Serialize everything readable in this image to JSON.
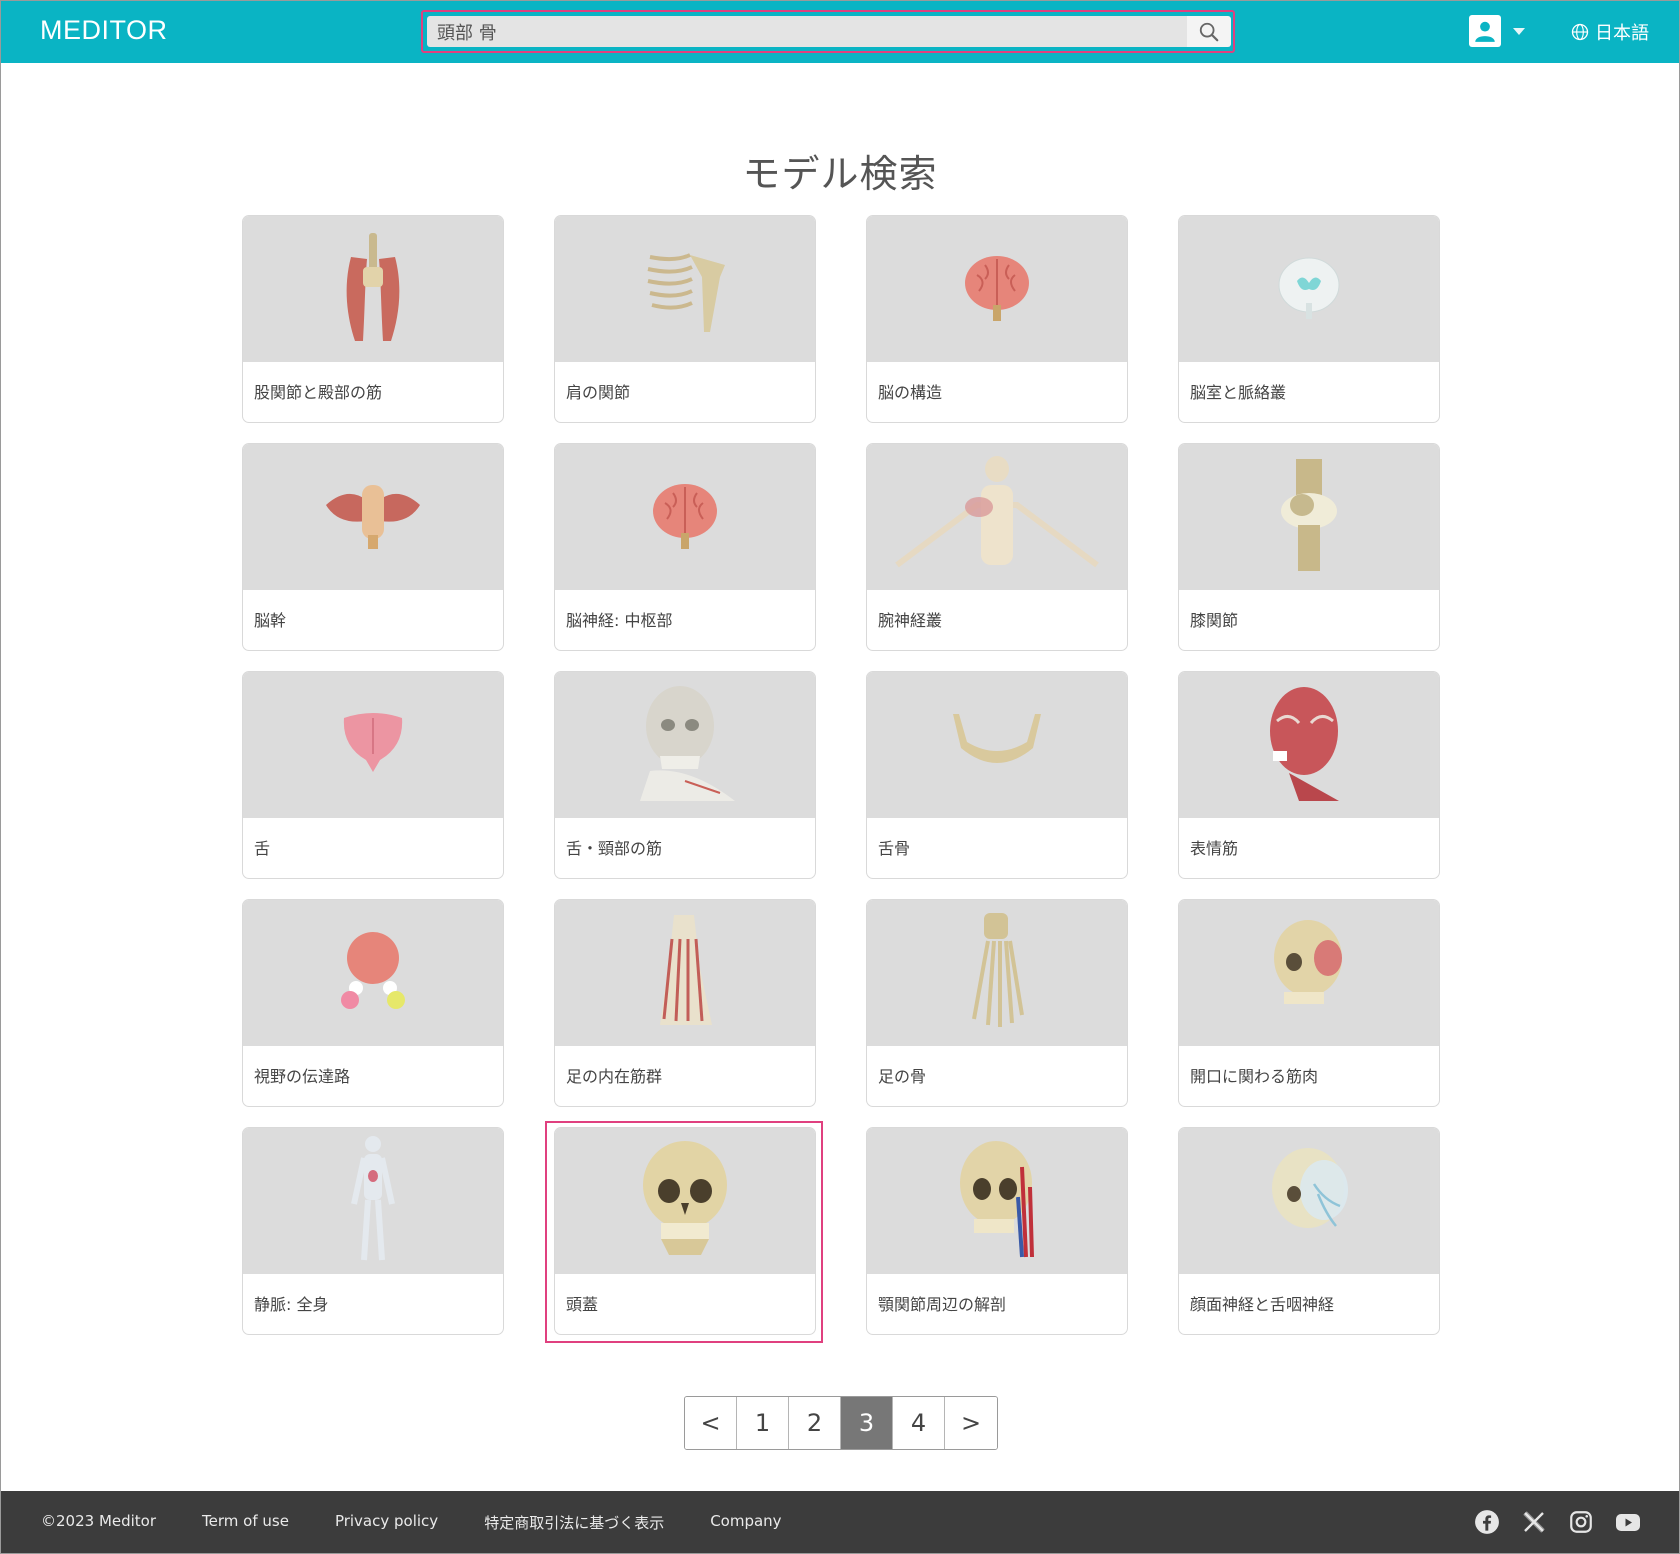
{
  "header": {
    "logo": "MEDITOR",
    "search_value": "頭部 骨",
    "language_label": "日本語"
  },
  "page": {
    "title": "モデル検索"
  },
  "models": [
    {
      "label": "股関節と殿部の筋",
      "icon": "hip-muscles-icon"
    },
    {
      "label": "肩の関節",
      "icon": "shoulder-joint-icon"
    },
    {
      "label": "脳の構造",
      "icon": "brain-icon"
    },
    {
      "label": "脳室と脈絡叢",
      "icon": "ventricles-icon"
    },
    {
      "label": "脳幹",
      "icon": "brainstem-icon"
    },
    {
      "label": "脳神経: 中枢部",
      "icon": "brain-icon"
    },
    {
      "label": "腕神経叢",
      "icon": "brachial-plexus-icon"
    },
    {
      "label": "膝関節",
      "icon": "knee-joint-icon"
    },
    {
      "label": "舌",
      "icon": "tongue-icon"
    },
    {
      "label": "舌・頸部の筋",
      "icon": "head-neck-icon"
    },
    {
      "label": "舌骨",
      "icon": "hyoid-bone-icon"
    },
    {
      "label": "表情筋",
      "icon": "facial-muscles-icon"
    },
    {
      "label": "視野の伝達路",
      "icon": "visual-pathway-icon"
    },
    {
      "label": "足の内在筋群",
      "icon": "foot-muscles-icon"
    },
    {
      "label": "足の骨",
      "icon": "foot-bones-icon"
    },
    {
      "label": "開口に関わる筋肉",
      "icon": "skull-muscles-icon"
    },
    {
      "label": "静脈: 全身",
      "icon": "body-veins-icon"
    },
    {
      "label": "頭蓋",
      "icon": "skull-icon"
    },
    {
      "label": "顎関節周辺の解剖",
      "icon": "tmj-anatomy-icon"
    },
    {
      "label": "顔面神経と舌咽神経",
      "icon": "facial-nerve-icon"
    }
  ],
  "pagination": {
    "prev": "<",
    "pages": [
      "1",
      "2",
      "3",
      "4"
    ],
    "current": "3",
    "next": ">"
  },
  "footer": {
    "copyright": "©2023 Meditor",
    "links": [
      "Term of use",
      "Privacy policy",
      "特定商取引法に基づく表示",
      "Company"
    ],
    "social": [
      "facebook-icon",
      "x-icon",
      "instagram-icon",
      "youtube-icon"
    ]
  },
  "colors": {
    "header": "#0ab4c4",
    "footer": "#3c3c3c",
    "highlight": "#e0407f",
    "active_page": "#777777"
  }
}
